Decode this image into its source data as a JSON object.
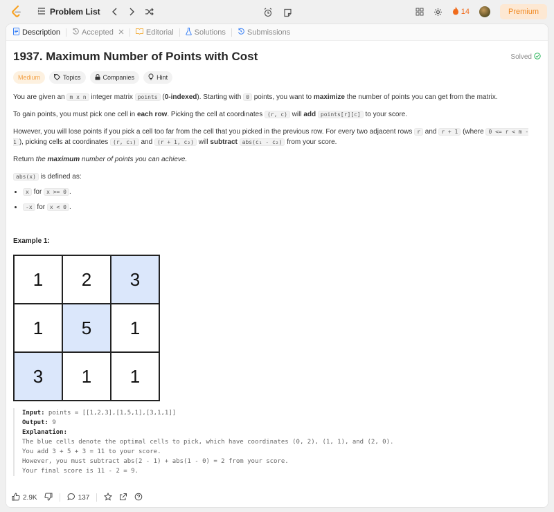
{
  "topbar": {
    "problem_list": "Problem List",
    "streak": "14",
    "premium": "Premium"
  },
  "tabs": [
    {
      "label": "Description"
    },
    {
      "label": "Accepted"
    },
    {
      "label": "Editorial"
    },
    {
      "label": "Solutions"
    },
    {
      "label": "Submissions"
    }
  ],
  "problem": {
    "title": "1937. Maximum Number of Points with Cost",
    "status": "Solved",
    "difficulty": "Medium",
    "tags": [
      "Topics",
      "Companies",
      "Hint"
    ]
  },
  "desc": {
    "p1": {
      "a": "You are given an ",
      "code1": "m x n",
      "b": " integer matrix ",
      "code2": "points",
      "c": " (",
      "bold1": "0-indexed",
      "d": "). Starting with ",
      "code3": "0",
      "e": " points, you want to ",
      "bold2": "maximize",
      "f": " the number of points you can get from the matrix."
    },
    "p2": {
      "a": "To gain points, you must pick one cell in ",
      "bold1": "each row",
      "b": ". Picking the cell at coordinates ",
      "code1": "(r, c)",
      "c": " will ",
      "bold2": "add",
      "d": " ",
      "code2": "points[r][c]",
      "e": " to your score."
    },
    "p3": {
      "a": "However, you will lose points if you pick a cell too far from the cell that you picked in the previous row. For every two adjacent rows ",
      "code1": "r",
      "b": " and ",
      "code2": "r + 1",
      "c": " (where ",
      "code3": "0 <= r < m - 1",
      "d": "), picking cells at coordinates ",
      "code4": "(r, c₁)",
      "e": " and ",
      "code5": "(r + 1, c₂)",
      "f": " will ",
      "bold1": "subtract",
      "g": " ",
      "code6": "abs(c₁ - c₂)",
      "h": " from your score."
    },
    "p4": {
      "a": "Return ",
      "i1": "the ",
      "bi": "maximum",
      "i2": " number of points you can achieve."
    },
    "p5": {
      "code1": "abs(x)",
      "a": " is defined as:"
    },
    "bullets": [
      {
        "code1": "x",
        "a": " for ",
        "code2": "x >= 0",
        "b": "."
      },
      {
        "code1": "-x",
        "a": " for ",
        "code2": "x < 0",
        "b": "."
      }
    ]
  },
  "example": {
    "heading": "Example 1:",
    "grid": [
      [
        "1",
        "2",
        "3"
      ],
      [
        "1",
        "5",
        "1"
      ],
      [
        "3",
        "1",
        "1"
      ]
    ],
    "input_label": "Input:",
    "input": " points = [[1,2,3],[1,5,1],[3,1,1]]",
    "output_label": "Output:",
    "output": " 9",
    "explanation_label": "Explanation:",
    "lines": [
      "The blue cells denote the optimal cells to pick, which have coordinates (0, 2), (1, 1), and (2, 0).",
      "You add 3 + 5 + 3 = 11 to your score.",
      "However, you must subtract abs(2 - 1) + abs(1 - 0) = 2 from your score.",
      "Your final score is 11 - 2 = 9."
    ]
  },
  "bottombar": {
    "likes": "2.9K",
    "comments": "137"
  },
  "colors": {
    "accent_orange": "#f3a34a",
    "solved_green": "#2db55d",
    "blue_cell": "#dbe7fb"
  }
}
